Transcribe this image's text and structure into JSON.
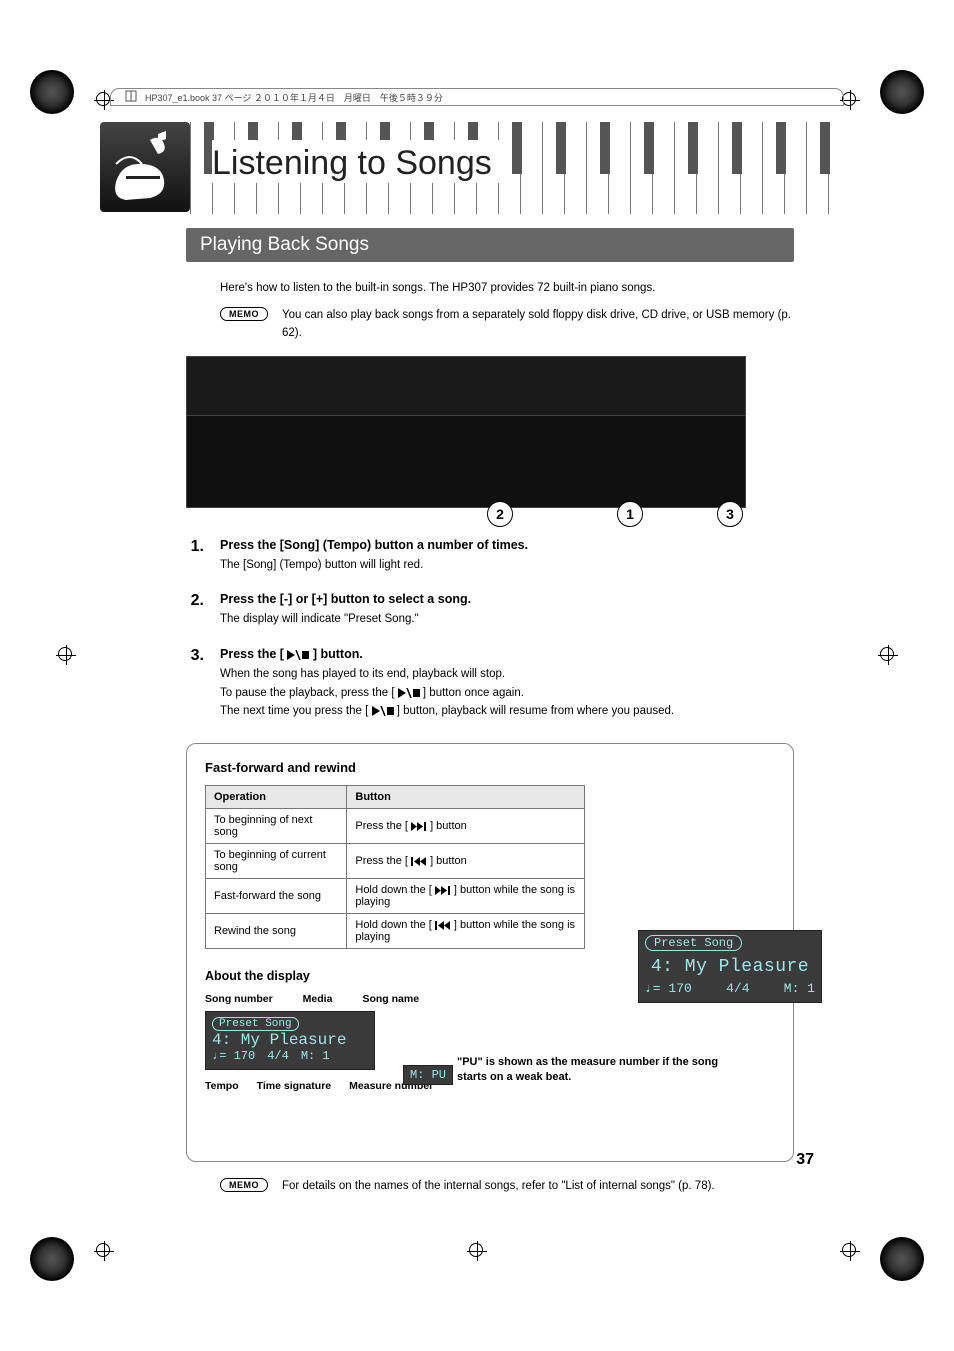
{
  "header_strip": "HP307_e1.book  37 ページ  ２０１０年１月４日　月曜日　午後５時３９分",
  "chapter_title": "Listening to Songs",
  "section_title": "Playing Back Songs",
  "intro_para": "Here's how to listen to the built-in songs. The HP307 provides 72 built-in piano songs.",
  "memo_label": "MEMO",
  "memo1_text": "You can also play back songs from a separately sold floppy disk drive, CD drive, or USB memory (p. 62).",
  "callouts": {
    "c1": "1",
    "c2": "2",
    "c3": "3"
  },
  "steps": [
    {
      "num": "1.",
      "title": "Press the [Song] (Tempo) button a number of times.",
      "lines": [
        "The [Song] (Tempo) button will light red."
      ]
    },
    {
      "num": "2.",
      "title": "Press the [-] or [+] button to select a song.",
      "lines": [
        "The display will indicate \"Preset Song.\""
      ]
    },
    {
      "num": "3.",
      "title_prefix": "Press the [ ",
      "title_suffix": " ] button.",
      "lines_parts": [
        [
          "When the song has played to its end, playback will stop."
        ],
        [
          "To pause the playback, press the [ ",
          "PLAYSTOP",
          " ] button once again."
        ],
        [
          "The next time you press the [ ",
          "PLAYSTOP",
          " ] button, playback will resume from where you paused."
        ]
      ]
    }
  ],
  "side_display": {
    "tab": "Preset Song",
    "main": "4: My Pleasure",
    "sub_left": "♩= 170",
    "sub_mid": "4/4",
    "sub_right": "M:   1"
  },
  "box_title": "Fast-forward and rewind",
  "ops_table": {
    "headers": [
      "Operation",
      "Button"
    ],
    "rows": [
      {
        "op": "To beginning of next song",
        "btn_pre": "Press the [ ",
        "btn_icon": "NEXT",
        "btn_post": " ] button"
      },
      {
        "op": "To beginning of current song",
        "btn_pre": "Press the [ ",
        "btn_icon": "PREV",
        "btn_post": " ] button"
      },
      {
        "op": "Fast-forward the song",
        "btn_pre": "Hold down the [ ",
        "btn_icon": "NEXT",
        "btn_post": " ] button while the song is playing"
      },
      {
        "op": "Rewind the song",
        "btn_pre": "Hold down the [ ",
        "btn_icon": "PREV",
        "btn_post": " ] button while the song is playing"
      }
    ]
  },
  "about_title": "About the display",
  "about_top_labels": [
    "Song number",
    "Media",
    "Song name"
  ],
  "about_display": {
    "tab": "Preset Song",
    "main": "4: My Pleasure",
    "sub_tempo": "♩= 170",
    "sub_sig": "4/4",
    "sub_meas": "M:   1"
  },
  "pu_badge": "M: PU",
  "pu_note": "\"PU\" is shown as the measure number if the song starts on a weak beat.",
  "about_bottom_labels": [
    "Tempo",
    "Time signature",
    "Measure number"
  ],
  "memo2_text": "For details on the names of the internal songs, refer to \"List of internal songs\" (p. 78).",
  "page_number": "37"
}
